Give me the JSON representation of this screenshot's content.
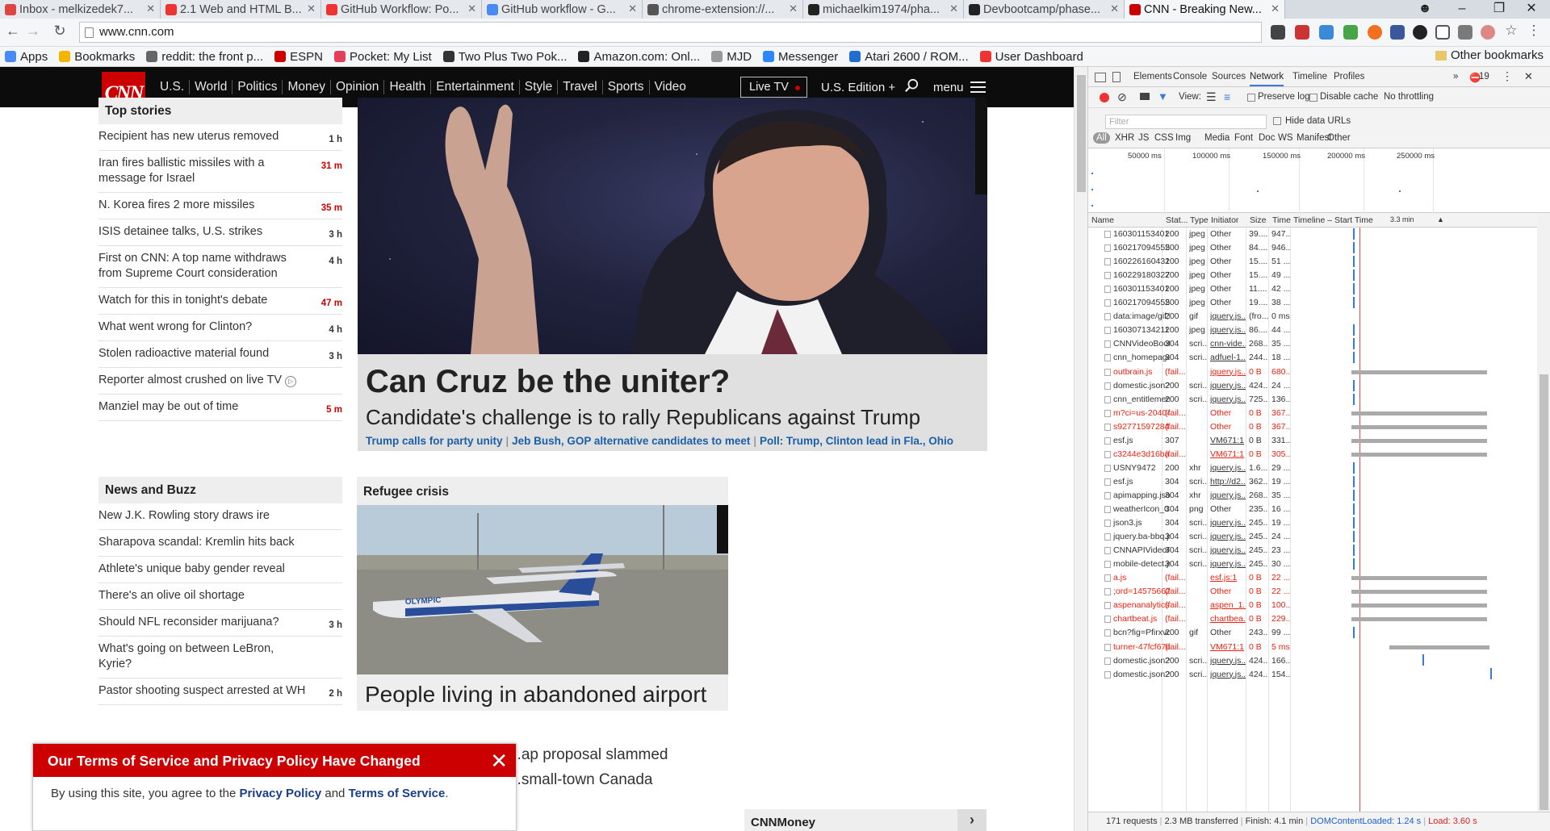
{
  "browser": {
    "tabs": [
      {
        "title": "Inbox - melkizedek7...",
        "favicon_color": "#d44"
      },
      {
        "title": "2.1 Web and HTML B...",
        "favicon_color": "#e33"
      },
      {
        "title": "GitHub Workflow: Po...",
        "favicon_color": "#e33"
      },
      {
        "title": "GitHub workflow - G...",
        "favicon_color": "#4a8af4"
      },
      {
        "title": "chrome-extension://...",
        "favicon_color": "#555"
      },
      {
        "title": "michaelkim1974/pha...",
        "favicon_color": "#222"
      },
      {
        "title": "Devbootcamp/phase...",
        "favicon_color": "#222"
      },
      {
        "title": "CNN - Breaking New...",
        "favicon_color": "#c00"
      }
    ],
    "url": "www.cnn.com",
    "bookmarks": [
      {
        "label": "Apps",
        "color": "#4a8af4"
      },
      {
        "label": "Bookmarks",
        "color": "#f5b400"
      },
      {
        "label": "reddit: the front p...",
        "color": "#666"
      },
      {
        "label": "ESPN",
        "color": "#c00"
      },
      {
        "label": "Pocket: My List",
        "color": "#e2405a"
      },
      {
        "label": "Two Plus Two Pok...",
        "color": "#333"
      },
      {
        "label": "Amazon.com: Onl...",
        "color": "#222"
      },
      {
        "label": "MJD",
        "color": "#999"
      },
      {
        "label": "Messenger",
        "color": "#2d88ff"
      },
      {
        "label": "Atari 2600 / ROM...",
        "color": "#1f6fd1"
      },
      {
        "label": "User Dashboard",
        "color": "#e33"
      }
    ],
    "other_bookmarks": "Other bookmarks"
  },
  "cnn": {
    "logo": "CNN",
    "nav": [
      "U.S.",
      "World",
      "Politics",
      "Money",
      "Opinion",
      "Health",
      "Entertainment",
      "Style",
      "Travel",
      "Sports",
      "Video"
    ],
    "live_tv": "Live TV",
    "edition": "U.S. Edition +",
    "menu": "menu",
    "top_stories": {
      "title": "Top stories",
      "items": [
        {
          "text": "Recipient has new uterus removed",
          "time": "1 h",
          "red": false
        },
        {
          "text": "Iran fires ballistic missiles with a message for Israel",
          "time": "31 m",
          "red": true
        },
        {
          "text": "N. Korea fires 2 more missiles",
          "time": "35 m",
          "red": true
        },
        {
          "text": "ISIS detainee talks, U.S. strikes",
          "time": "3 h",
          "red": false
        },
        {
          "text": "First on CNN: A top name withdraws from Supreme Court consideration",
          "time": "4 h",
          "red": false
        },
        {
          "text": "Watch for this in tonight's debate",
          "time": "47 m",
          "red": true
        },
        {
          "text": "What went wrong for Clinton?",
          "time": "4 h",
          "red": false
        },
        {
          "text": "Stolen radioactive material found",
          "time": "3 h",
          "red": false
        },
        {
          "text": "Reporter almost crushed on live TV",
          "time": "",
          "red": false
        },
        {
          "text": "Manziel may be out of time",
          "time": "5 m",
          "red": true
        }
      ]
    },
    "hero": {
      "headline": "Can Cruz be the uniter?",
      "subhead": "Candidate's challenge is to rally Republicans against Trump",
      "links": [
        "Trump calls for party unity",
        "Jeb Bush, GOP alternative candidates to meet",
        "Poll: Trump, Clinton lead in Fla., Ohio"
      ]
    },
    "news_buzz": {
      "title": "News and Buzz",
      "items": [
        {
          "text": "New J.K. Rowling story draws ire",
          "time": ""
        },
        {
          "text": "Sharapova scandal: Kremlin hits back",
          "time": ""
        },
        {
          "text": "Athlete's unique baby gender reveal",
          "time": ""
        },
        {
          "text": "There's an olive oil shortage",
          "time": ""
        },
        {
          "text": "Should NFL reconsider marijuana?",
          "time": "3 h"
        },
        {
          "text": "What's going on between LeBron, Kyrie?",
          "time": ""
        },
        {
          "text": "Pastor shooting suspect arrested at WH",
          "time": "2 h"
        }
      ]
    },
    "refugee": {
      "title": "Refugee crisis",
      "caption": "People living in abandoned airport",
      "plane_text": "OLYMPIC",
      "below1": "...ap proposal slammed",
      "below2": "...small-town Canada"
    },
    "cnnmoney": "CNNMoney",
    "tos": {
      "title": "Our Terms of Service and Privacy Policy Have Changed",
      "text_a": "By using this site, you agree to the ",
      "link_privacy": "Privacy Policy",
      "text_and": " and ",
      "link_terms": "Terms of Service",
      "text_end": "."
    }
  },
  "devtools": {
    "tabs": [
      "Elements",
      "Console",
      "Sources",
      "Network",
      "Timeline",
      "Profiles"
    ],
    "errors": "19",
    "view_label": "View:",
    "preserve_log": "Preserve log",
    "disable_cache": "Disable cache",
    "throttling": "No throttling",
    "filter_placeholder": "Filter",
    "hide_data_urls": "Hide data URLs",
    "types": [
      "All",
      "XHR",
      "JS",
      "CSS",
      "Img",
      "Media",
      "Font",
      "Doc",
      "WS",
      "Manifest",
      "Other"
    ],
    "overview_ticks": [
      "50000 ms",
      "100000 ms",
      "150000 ms",
      "200000 ms",
      "250000 ms"
    ],
    "columns": [
      "Name",
      "Stat...",
      "Type",
      "Initiator",
      "Size",
      "Time",
      "Timeline – Start Time",
      "3.3 min"
    ],
    "requests": [
      {
        "name": "160301153401-p...",
        "status": "200",
        "type": "jpeg",
        "initiator": "Other",
        "size": "39....",
        "time": "947...",
        "err": false,
        "bar": "tick"
      },
      {
        "name": "160217094555-0...",
        "status": "200",
        "type": "jpeg",
        "initiator": "Other",
        "size": "84....",
        "time": "946...",
        "err": false,
        "bar": "tick"
      },
      {
        "name": "160226160431-0...",
        "status": "200",
        "type": "jpeg",
        "initiator": "Other",
        "size": "15....",
        "time": "51 ...",
        "err": false,
        "bar": "tick"
      },
      {
        "name": "160229180327-0...",
        "status": "200",
        "type": "jpeg",
        "initiator": "Other",
        "size": "15....",
        "time": "49 ...",
        "err": false,
        "bar": "tick"
      },
      {
        "name": "160301153401-p...",
        "status": "200",
        "type": "jpeg",
        "initiator": "Other",
        "size": "11....",
        "time": "42 ...",
        "err": false,
        "bar": "tick"
      },
      {
        "name": "160217094555-0...",
        "status": "200",
        "type": "jpeg",
        "initiator": "Other",
        "size": "19....",
        "time": "38 ...",
        "err": false,
        "bar": "tick"
      },
      {
        "name": "data:image/gif;b...",
        "status": "200",
        "type": "gif",
        "initiator": "jquery.js...",
        "size": "(fro...",
        "time": "0 ms",
        "err": false,
        "bar": "none"
      },
      {
        "name": "160307134211-e...",
        "status": "200",
        "type": "jpeg",
        "initiator": "jquery.js...",
        "size": "86....",
        "time": "44 ...",
        "err": false,
        "bar": "tick"
      },
      {
        "name": "CNNVideoBoots...",
        "status": "304",
        "type": "scri...",
        "initiator": "cnn-vide...",
        "size": "268...",
        "time": "35 ...",
        "err": false,
        "bar": "tick"
      },
      {
        "name": "cnn_homepage.js",
        "status": "304",
        "type": "scri...",
        "initiator": "adfuel-1...",
        "size": "244...",
        "time": "18 ...",
        "err": false,
        "bar": "tick"
      },
      {
        "name": "outbrain.js",
        "status": "(fail...",
        "type": "",
        "initiator": "jquery.js...",
        "size": "0 B",
        "time": "680...",
        "err": true,
        "bar": "long"
      },
      {
        "name": "domestic.json?c...",
        "status": "200",
        "type": "scri...",
        "initiator": "jquery.js...",
        "size": "424...",
        "time": "24 ...",
        "err": false,
        "bar": "tick"
      },
      {
        "name": "cnn_entitlement...",
        "status": "200",
        "type": "scri...",
        "initiator": "jquery.js...",
        "size": "725...",
        "time": "136...",
        "err": false,
        "bar": "tick"
      },
      {
        "name": "m?ci=us-204044...",
        "status": "(fail...",
        "type": "",
        "initiator": "Other",
        "size": "0 B",
        "time": "367...",
        "err": true,
        "bar": "long"
      },
      {
        "name": "s92771597284 81...",
        "status": "(fail...",
        "type": "",
        "initiator": "Other",
        "size": "0 B",
        "time": "367...",
        "err": true,
        "bar": "long"
      },
      {
        "name": "esf.js",
        "status": "307",
        "type": "",
        "initiator": "VM671:1",
        "size": "0 B",
        "time": "331...",
        "err": false,
        "bar": "long"
      },
      {
        "name": "c3244e3d16ba.js...",
        "status": "(fail...",
        "type": "",
        "initiator": "VM671:1",
        "size": "0 B",
        "time": "305...",
        "err": true,
        "bar": "long"
      },
      {
        "name": "USNY9472",
        "status": "200",
        "type": "xhr",
        "initiator": "jquery.js...",
        "size": "1.6...",
        "time": "29 ...",
        "err": false,
        "bar": "tick"
      },
      {
        "name": "esf.js",
        "status": "304",
        "type": "scri...",
        "initiator": "http://d2...",
        "size": "362...",
        "time": "19 ...",
        "err": false,
        "bar": "tick"
      },
      {
        "name": "apimapping.json...",
        "status": "304",
        "type": "xhr",
        "initiator": "jquery.js...",
        "size": "268...",
        "time": "35 ...",
        "err": false,
        "bar": "tick"
      },
      {
        "name": "weatherIcon_01...",
        "status": "304",
        "type": "png",
        "initiator": "Other",
        "size": "235...",
        "time": "16 ...",
        "err": false,
        "bar": "tick"
      },
      {
        "name": "json3.js",
        "status": "304",
        "type": "scri...",
        "initiator": "jquery.js...",
        "size": "245...",
        "time": "19 ...",
        "err": false,
        "bar": "tick"
      },
      {
        "name": "jquery.ba-bbq.js",
        "status": "304",
        "type": "scri...",
        "initiator": "jquery.js...",
        "size": "245...",
        "time": "24 ...",
        "err": false,
        "bar": "tick"
      },
      {
        "name": "CNNAPIVideoPl...",
        "status": "304",
        "type": "scri...",
        "initiator": "jquery.js...",
        "size": "245...",
        "time": "23 ...",
        "err": false,
        "bar": "tick"
      },
      {
        "name": "mobile-detect.js",
        "status": "304",
        "type": "scri...",
        "initiator": "jquery.js...",
        "size": "245...",
        "time": "30 ...",
        "err": false,
        "bar": "tick"
      },
      {
        "name": "a.js",
        "status": "(fail...",
        "type": "",
        "initiator": "esf.js:1",
        "size": "0 B",
        "time": "22 ...",
        "err": true,
        "bar": "long"
      },
      {
        "name": ";ord=145756625...",
        "status": "(fail...",
        "type": "",
        "initiator": "Other",
        "size": "0 B",
        "time": "22 ...",
        "err": true,
        "bar": "long"
      },
      {
        "name": "aspenanalytics.js...",
        "status": "(fail...",
        "type": "",
        "initiator": "aspen_1...",
        "size": "0 B",
        "time": "100...",
        "err": true,
        "bar": "long"
      },
      {
        "name": "chartbeat.js",
        "status": "(fail...",
        "type": "",
        "initiator": "chartbea...",
        "size": "0 B",
        "time": "229...",
        "err": true,
        "bar": "long"
      },
      {
        "name": "bcn?fig=Pfirxvqv...",
        "status": "200",
        "type": "gif",
        "initiator": "Other",
        "size": "243...",
        "time": "99 ...",
        "err": false,
        "bar": "tick"
      },
      {
        "name": "turner-47fcf67ur...",
        "status": "(fail...",
        "type": "",
        "initiator": "VM671:1",
        "size": "0 B",
        "time": "5 ms",
        "err": true,
        "bar": "late"
      },
      {
        "name": "domestic.json?c...",
        "status": "200",
        "type": "scri...",
        "initiator": "jquery.js...",
        "size": "424...",
        "time": "166...",
        "err": false,
        "bar": "tick2"
      },
      {
        "name": "domestic.json?c...",
        "status": "200",
        "type": "scri...",
        "initiator": "jquery.js...",
        "size": "424...",
        "time": "154...",
        "err": false,
        "bar": "tick3"
      }
    ],
    "status": {
      "requests": "171 requests",
      "transferred": "2.3 MB transferred",
      "finish": "Finish: 4.1 min",
      "dcl": "DOMContentLoaded: 1.24 s",
      "load": "Load: 3.60 s"
    }
  }
}
